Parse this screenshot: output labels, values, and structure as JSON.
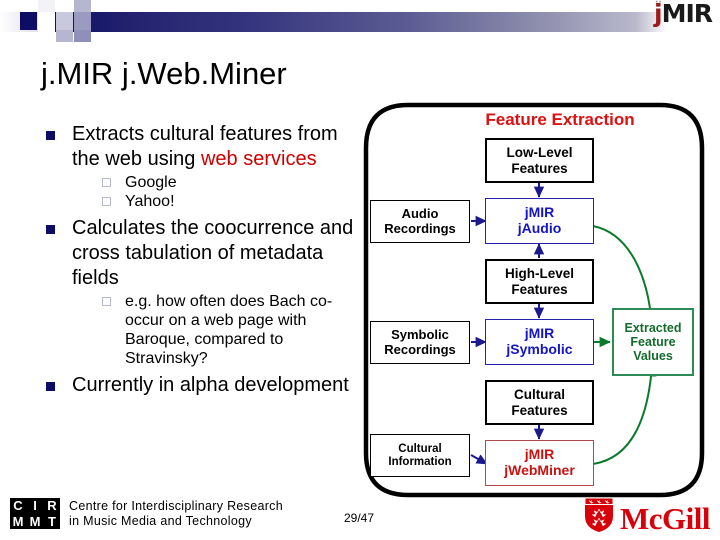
{
  "logo": {
    "brand_j": "j",
    "brand_mir": "MIR"
  },
  "slide": {
    "title": "j.MIR j.Web.Miner",
    "page_number": "29/47"
  },
  "bullets": [
    {
      "text_plain": "Extracts cultural features from the web using ",
      "text_accent": "web services",
      "accent_color": "#cc0000",
      "sub": [
        "Google",
        "Yahoo!"
      ]
    },
    {
      "text_plain": "Calculates the coocurrence and cross tabulation of metadata fields",
      "text_accent": "",
      "sub": [
        "e.g. how often does Bach co-occur on a web page with Baroque, compared to Stravinsky?"
      ]
    },
    {
      "text_plain": "Currently in alpha development",
      "text_accent": "",
      "sub": []
    }
  ],
  "diagram": {
    "heading": "Feature Extraction",
    "heading_color": "#dd1111",
    "boxes": {
      "low_level": "Low-Level Features",
      "high_level": "High-Level Features",
      "cultural_features": "Cultural Features",
      "audio_recordings": "Audio Recordings",
      "symbolic_recordings": "Symbolic Recordings",
      "cultural_information": "Cultural Information",
      "jaudio": "jMIR jAudio",
      "jaudio_line1": "jMIR",
      "jaudio_line2": "jAudio",
      "jsymbolic_line1": "jMIR",
      "jsymbolic_line2": "jSymbolic",
      "jwebminer_line1": "jMIR",
      "jwebminer_line2": "jWebMiner",
      "extracted": "Extracted Feature Values"
    },
    "colors": {
      "blue_box": "#1414c8",
      "red_box": "#cc1111",
      "green_box": "#156b2e",
      "arrow_blue": "#1a1a8c",
      "arrow_green": "#0c7a2c"
    }
  },
  "footer": {
    "cirmmt_letters": [
      "C",
      "I",
      "R",
      "M",
      "M",
      "T"
    ],
    "cirmmt_line1": "Centre for Interdisciplinary Research",
    "cirmmt_line2": "in Music Media and Technology",
    "mcgill_word": "McGill"
  }
}
